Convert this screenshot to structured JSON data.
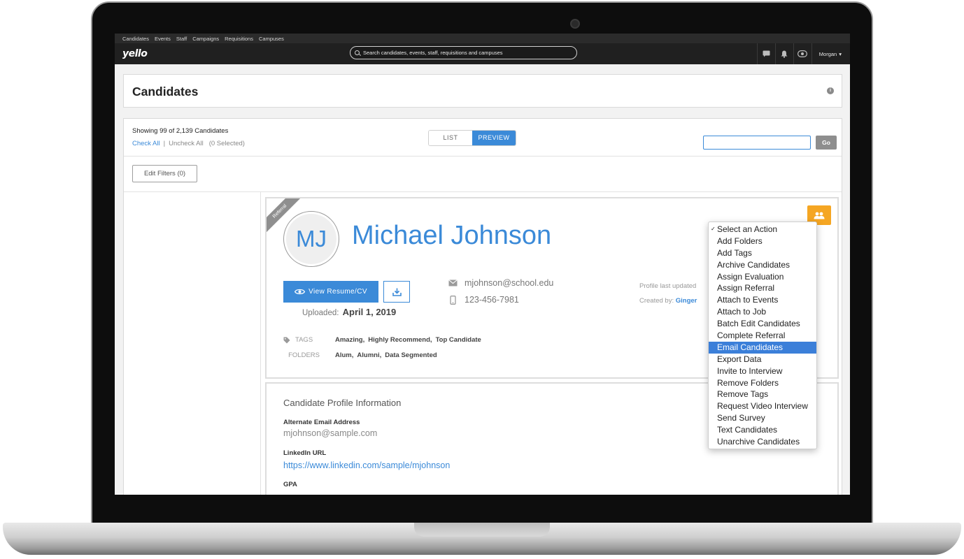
{
  "nav": {
    "items": [
      "Candidates",
      "Events",
      "Staff",
      "Campaigns",
      "Requisitions",
      "Campuses"
    ]
  },
  "header": {
    "logo": "yello",
    "search_placeholder": "Search candidates, events, staff, requisitions and campuses",
    "user": "Morgan"
  },
  "page": {
    "title": "Candidates"
  },
  "toolbar": {
    "showing": "Showing 99 of 2,139 Candidates",
    "check_all": "Check All",
    "separator": "|",
    "uncheck_all": "Uncheck All",
    "selected": "(0 Selected)",
    "view_list": "LIST",
    "view_preview": "PREVIEW",
    "go": "Go",
    "edit_filters": "Edit Filters (0)"
  },
  "actions": {
    "items": [
      "Select an Action",
      "Add Folders",
      "Add Tags",
      "Archive Candidates",
      "Assign Evaluation",
      "Assign Referral",
      "Attach to Events",
      "Attach to Job",
      "Batch Edit Candidates",
      "Complete Referral",
      "Email Candidates",
      "Export Data",
      "Invite to Interview",
      "Remove Folders",
      "Remove Tags",
      "Request Video Interview",
      "Send Survey",
      "Text Candidates",
      "Unarchive Candidates"
    ],
    "checked": "Select an Action",
    "highlighted": "Email Candidates"
  },
  "candidate": {
    "ribbon": "Referral",
    "initials": "MJ",
    "name": "Michael Johnson",
    "view_resume": "View Resume/CV",
    "uploaded_label": "Uploaded:",
    "uploaded_date": "April 1, 2019",
    "email": "mjohnson@school.edu",
    "phone": "123-456-7981",
    "profile_updated": "Profile last updated",
    "created_by_label": "Created by:",
    "created_by": "Ginger",
    "tags_label": "TAGS",
    "tags": [
      "Amazing,",
      "Highly Recommend,",
      "Top Candidate"
    ],
    "folders_label": "FOLDERS",
    "folders": [
      "Alum,",
      "Alumni,",
      "Data Segmented"
    ]
  },
  "profile_info": {
    "title": "Candidate Profile Information",
    "alt_email_label": "Alternate Email Address",
    "alt_email": "mjohnson@sample.com",
    "linkedin_label": "LinkedIn URL",
    "linkedin": "https://www.linkedin.com/sample/mjohnson",
    "gpa_label": "GPA"
  },
  "colors": {
    "accent": "#3b8ad8",
    "orange": "#f5a623",
    "header": "#202020"
  }
}
